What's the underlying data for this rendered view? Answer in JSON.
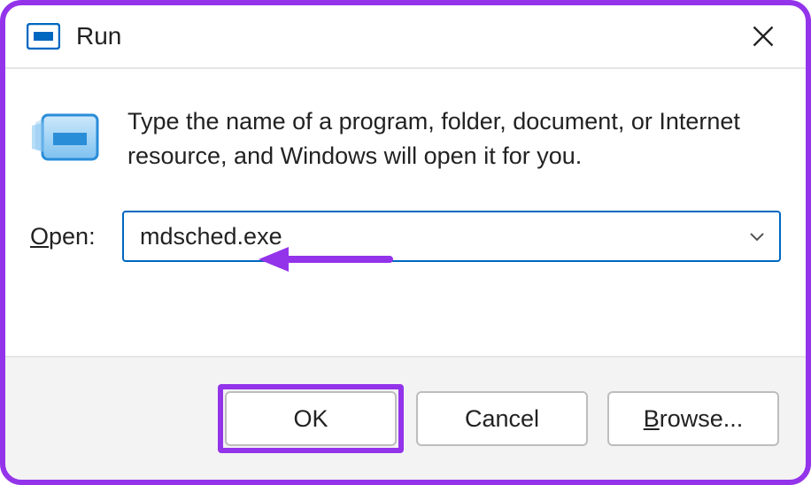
{
  "titlebar": {
    "title": "Run"
  },
  "content": {
    "description": "Type the name of a program, folder, document, or Internet resource, and Windows will open it for you.",
    "open_label_underline": "O",
    "open_label_rest": "pen:",
    "input_value": "mdsched.exe"
  },
  "footer": {
    "ok_label": "OK",
    "cancel_label": "Cancel",
    "browse_underline": "B",
    "browse_rest": "rowse..."
  }
}
